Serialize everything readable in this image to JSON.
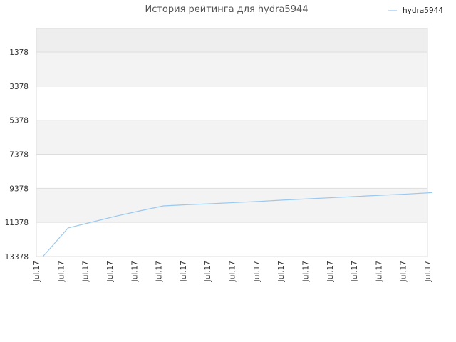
{
  "chart_data": {
    "type": "line",
    "title": "История рейтинга для hydra5944",
    "xlabel": "",
    "ylabel": "",
    "y_axis_inverted": true,
    "ylim": [
      13378,
      0
    ],
    "y_ticks": [
      "1378",
      "3378",
      "5378",
      "7378",
      "9378",
      "11378",
      "13378"
    ],
    "y_tick_values": [
      1378,
      3378,
      5378,
      7378,
      9378,
      11378,
      13378
    ],
    "x_ticks": [
      "Jul.17",
      "Jul.17",
      "Jul.17",
      "Jul.17",
      "Jul.17",
      "Jul.17",
      "Jul.17",
      "Jul.17",
      "Jul.17",
      "Jul.17",
      "Jul.17",
      "Jul.17",
      "Jul.17",
      "Jul.17",
      "Jul.17",
      "Jul.17",
      "Jul.17"
    ],
    "grid": true,
    "band_colors": [
      "#eeeeee",
      "#f3f3f3",
      "#ffffff",
      "#f3f3f3",
      "#ffffff",
      "#f3f3f3",
      "#ffffff"
    ],
    "legend_position": "top-right",
    "series": [
      {
        "name": "hydra5944",
        "color": "#99c8f0",
        "x": [
          0.27,
          1.3,
          2.3,
          3.3,
          4.3,
          5.2,
          6.2,
          7.2,
          8.2,
          9.2,
          10.2,
          11.2,
          12.2,
          13.2,
          14.2,
          15.2,
          16.2
        ],
        "values": [
          13378,
          11700,
          11350,
          11000,
          10680,
          10410,
          10340,
          10280,
          10210,
          10140,
          10060,
          9990,
          9920,
          9850,
          9780,
          9710,
          9630
        ]
      }
    ]
  }
}
